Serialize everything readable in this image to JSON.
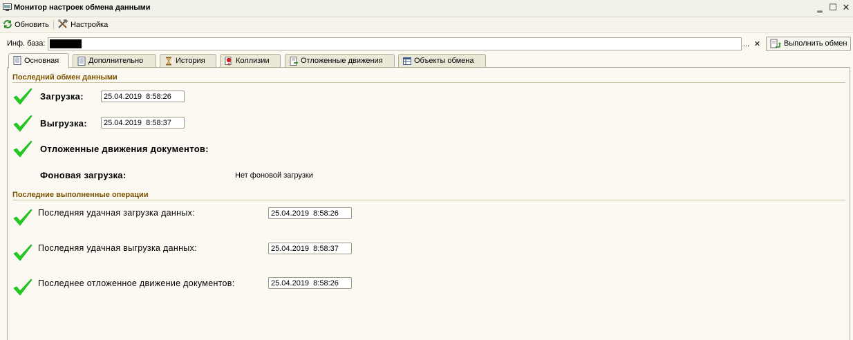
{
  "window": {
    "title": "Монитор настроек обмена данными",
    "minimize": "‗",
    "maximize": "☐",
    "close": "✕"
  },
  "toolbar": {
    "refresh_label": "Обновить",
    "settings_label": "Настройка"
  },
  "infobase": {
    "label": "Инф. база:",
    "value": "",
    "select_btn": "...",
    "clear_btn": "✕",
    "execute_label": "Выполнить обмен"
  },
  "tabs": [
    {
      "label": "Основная",
      "icon": "document-icon"
    },
    {
      "label": "Дополнительно",
      "icon": "document-icon"
    },
    {
      "label": "История",
      "icon": "hourglass-icon"
    },
    {
      "label": "Коллизии",
      "icon": "collision-icon"
    },
    {
      "label": "Отложенные движения",
      "icon": "deferred-icon"
    },
    {
      "label": "Объекты обмена",
      "icon": "objects-icon"
    }
  ],
  "last_exchange": {
    "title": "Последний обмен данными",
    "load_label": "Загрузка:",
    "load_value": "25.04.2019  8:58:26",
    "unload_label": "Выгрузка:",
    "unload_value": "25.04.2019  8:58:37",
    "deferred_label": "Отложенные движения документов:",
    "background_label": "Фоновая загрузка:",
    "background_value": "Нет фоновой загрузки"
  },
  "last_operations": {
    "title": "Последние выполненные операции",
    "load_label": "Последняя удачная загрузка данных:",
    "load_value": "25.04.2019  8:58:26",
    "unload_label": "Последняя удачная выгрузка данных:",
    "unload_value": "25.04.2019  8:58:37",
    "deferred_label": "Последнее отложенное движение документов:",
    "deferred_value": "25.04.2019  8:58:26"
  },
  "colors": {
    "check_green": "#1fcf1f",
    "section_title": "#7a5200"
  }
}
